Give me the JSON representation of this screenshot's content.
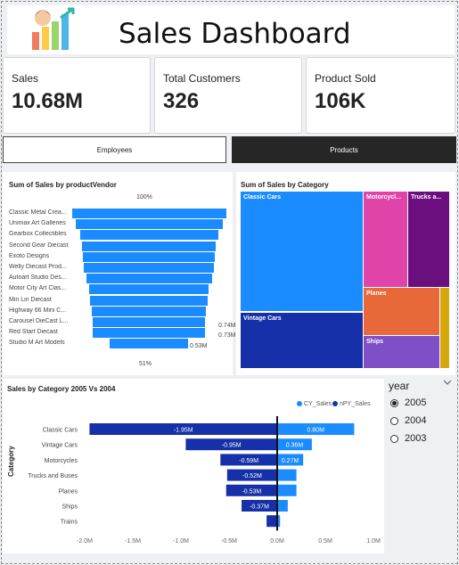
{
  "header": {
    "title": "Sales Dashboard"
  },
  "kpis": [
    {
      "label": "Sales",
      "value": "10.68M"
    },
    {
      "label": "Total Customers",
      "value": "326"
    },
    {
      "label": "Product Sold",
      "value": "106K"
    }
  ],
  "nav": {
    "employees": "Employees",
    "products": "Products"
  },
  "funnel": {
    "title": "Sum of Sales by productVendor",
    "top_pct": "100%",
    "bottom_pct": "51%",
    "labels": [
      "Classic Metal Crea...",
      "Unimax Art Galleries",
      "Gearbox Collectibles",
      "Second Gear Diecast",
      "Exoto Designs",
      "Welly Diecast Prod...",
      "Autoart Studio Des...",
      "Motor City Art Clas...",
      "Min Lin Diecast",
      "Highway 66 Mini C...",
      "Carousel DieCast L...",
      "Red Start Diecast",
      "Studio M Art Models"
    ],
    "value_labels": [
      "0.74M",
      "0.73M",
      "0.53M"
    ]
  },
  "treemap": {
    "title": "Sum of Sales by Category",
    "tiles": [
      "Classic Cars",
      "Vintage Cars",
      "Motorcycl...",
      "Trucks a...",
      "Planes",
      "Ships"
    ]
  },
  "chart_data": {
    "type": "bar",
    "title": "Sales by Category 2005 Vs 2004",
    "ylabel": "Category",
    "categories": [
      "Classic Cars",
      "Vintage Cars",
      "Motorcycles",
      "Trucks and Buses",
      "Planes",
      "Ships",
      "Trains"
    ],
    "series": [
      {
        "name": "CY_Sales",
        "color": "#1a8cff",
        "values": [
          0.8,
          0.36,
          0.27,
          0.2,
          0.2,
          0.11,
          0.03
        ],
        "labels": [
          "0.80M",
          "0.36M",
          "0.27M",
          "",
          "",
          "",
          ""
        ]
      },
      {
        "name": "nPY_Sales",
        "color": "#1530a8",
        "values": [
          -1.95,
          -0.95,
          -0.59,
          -0.52,
          -0.53,
          -0.37,
          -0.11
        ],
        "labels": [
          "-1.95M",
          "-0.95M",
          "-0.59M",
          "-0.52M",
          "-0.53M",
          "-0.37M",
          ""
        ]
      }
    ],
    "xticks": [
      "-2.0M",
      "-1.5M",
      "-1.0M",
      "-0.5M",
      "0.0M",
      "0.5M",
      "1.0M"
    ],
    "xlim": [
      -2.0,
      1.0
    ],
    "legend_position": "top-right"
  },
  "slicer": {
    "title": "year",
    "options": [
      "2005",
      "2004",
      "2003"
    ],
    "selected": "2005"
  }
}
